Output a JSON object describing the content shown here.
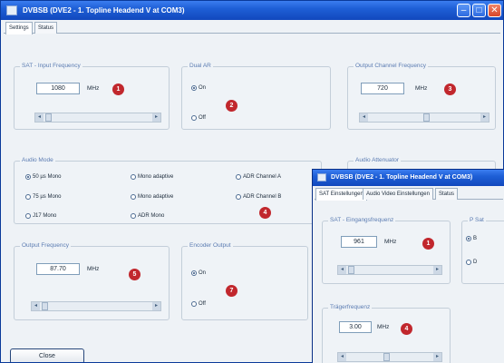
{
  "main_window": {
    "title": "DVBSB (DVE2 - 1. Topline Headend V at COM3)",
    "tabs": [
      {
        "label": "Settings"
      },
      {
        "label": "Status"
      }
    ],
    "rf_input": {
      "label": "SAT - Input Frequency",
      "value": "1080",
      "unit": "MHz",
      "badge": "1"
    },
    "dual_ar": {
      "label": "Dual AR",
      "options": [
        {
          "label": "On"
        },
        {
          "label": "Off"
        }
      ],
      "selected": 0,
      "badge": "2"
    },
    "output_channel": {
      "label": "Output Channel Frequency",
      "value": "720",
      "unit": "MHz",
      "badge": "3"
    },
    "audio_mode": {
      "label": "Audio Mode",
      "options": [
        {
          "label": "50 µs Mono"
        },
        {
          "label": "Mono adaptive"
        },
        {
          "label": "ADR Channel A"
        },
        {
          "label": "75 µs Mono"
        },
        {
          "label": "Mono adaptive"
        },
        {
          "label": "ADR Channel B"
        },
        {
          "label": "J17 Mono"
        },
        {
          "label": "ADR Mono"
        }
      ],
      "selected": 0,
      "badge": "4"
    },
    "audio_attenuation": {
      "label": "Audio Attenuator"
    },
    "output_frequency": {
      "label": "Output Frequency",
      "value": "87.70",
      "unit": "MHz",
      "badge": "5"
    },
    "encoder_output": {
      "label": "Encoder Output",
      "options": [
        {
          "label": "On"
        },
        {
          "label": "Off"
        }
      ],
      "selected": 0,
      "badge": "7"
    },
    "close_label": "Close"
  },
  "sub_window": {
    "title": "DVBSB (DVE2 - 1. Topline Headend V at COM3)",
    "tabs": [
      {
        "label": "SAT Einstellungen"
      },
      {
        "label": "Audio Video Einstellungen"
      },
      {
        "label": "Status"
      }
    ],
    "rf_input": {
      "label": "SAT - Eingangsfrequenz",
      "value": "961",
      "unit": "MHz",
      "badge": "1"
    },
    "right_panel": {
      "label": "P Sat",
      "options": [
        {
          "label": "B"
        },
        {
          "label": "D"
        }
      ]
    },
    "carrier_freq": {
      "label": "Trägerfrequenz",
      "value": "3.00",
      "unit": "MHz",
      "badge": "4"
    }
  }
}
